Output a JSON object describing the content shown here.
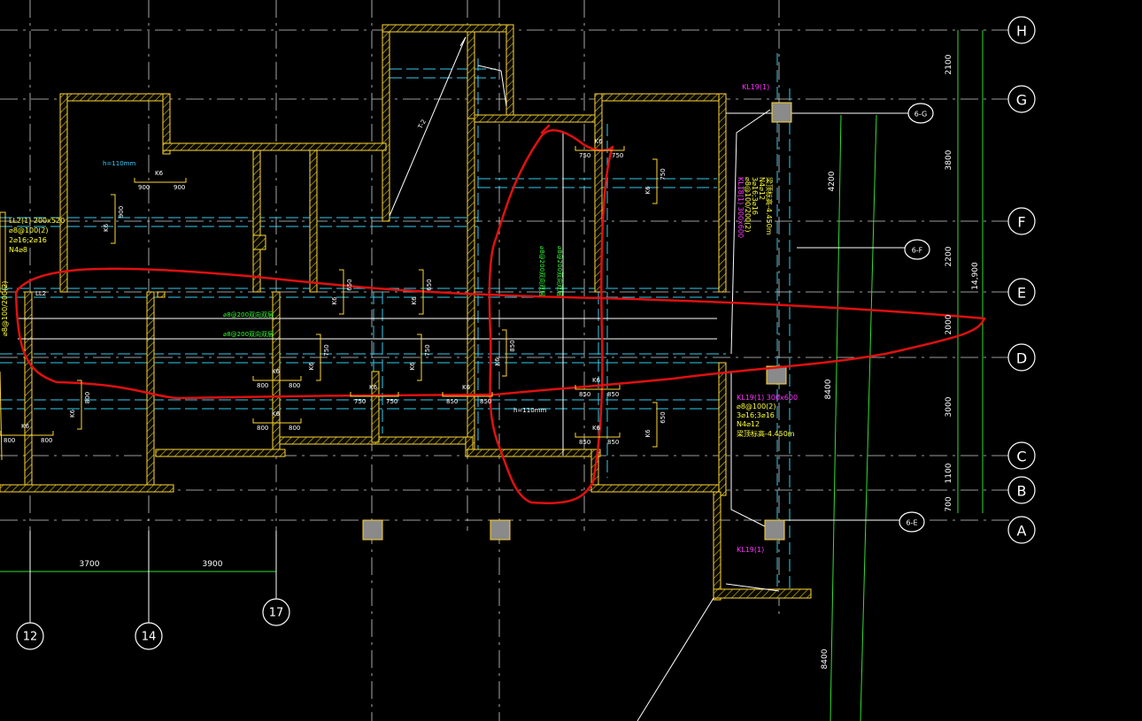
{
  "grid_axes": {
    "rows": [
      "H",
      "G",
      "F",
      "E",
      "D",
      "C",
      "B",
      "A"
    ],
    "columns": [
      "12",
      "14",
      "17"
    ],
    "sub_axes": [
      "6-G",
      "6-F",
      "6-E"
    ]
  },
  "dimensions": {
    "right_segments": [
      "2100",
      "3800",
      "2200",
      "2000",
      "3000",
      "1100",
      "700"
    ],
    "right_total": "14,900",
    "bottom_spans": [
      "3700",
      "3900"
    ],
    "vertical_spans": [
      "4200",
      "8400",
      "8400"
    ]
  },
  "beam_labels": {
    "kl19_top": "KL19(1)",
    "kl19_bottom": "KL19(1)",
    "kl18_lines": [
      "KL18(1) 300x600",
      "⌀8@100/200(2)",
      "3⌀16;3⌀16",
      "N4⌀12",
      "梁顶标高-4.450m"
    ],
    "kl19_mid_lines": [
      "KL19(1) 300x600",
      "⌀8@100(2)",
      "3⌀16;3⌀16",
      "N4⌀12",
      "梁顶标高-4.450m"
    ],
    "ll2_lines": [
      "LL2(1) 200x520",
      "⌀8@100(2)",
      "2⌀16;2⌀16",
      "N4⌀8"
    ],
    "left_vertical": "⌀8@100/200(2)",
    "ll_short": "LL2"
  },
  "slab_labels": {
    "h1": "h=110mm",
    "h2": "h=110mm",
    "green_horizontal": [
      "⌀8@200双向双层",
      "⌀8@200双向双层"
    ],
    "green_vertical": [
      "⌀8@200双向双层",
      "⌀8@200双向双层"
    ],
    "stair": "T-2"
  },
  "rebar_labels": {
    "k6": "K6",
    "values": [
      "900",
      "800",
      "750",
      "650",
      "850"
    ]
  },
  "colors": {
    "background": "#000000",
    "wall": "#ffd633",
    "grid_line": "#ffffff",
    "beam_line": "#33ccff",
    "dim_line": "#33ff33",
    "markup": "#e01010",
    "column_fill": "#8a8a8a"
  }
}
